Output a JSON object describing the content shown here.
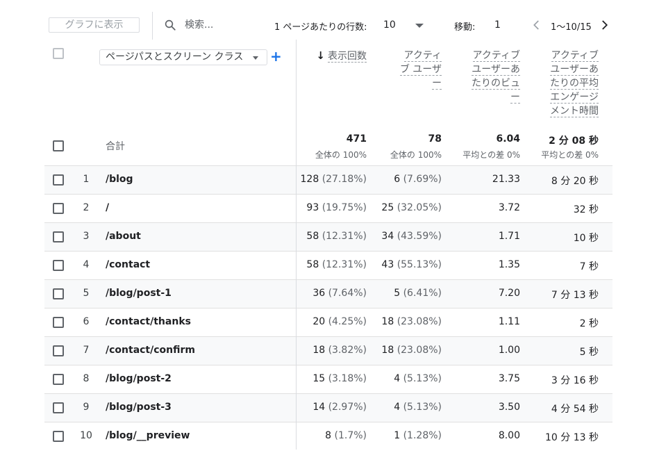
{
  "toolbar": {
    "graph_button": "グラフに表示",
    "search_placeholder": "検索...",
    "rows_per_page_label": "1 ページあたりの行数:",
    "rows_per_page_value": "10",
    "goto_label": "移動:",
    "goto_value": "1",
    "page_range": "1〜10/15"
  },
  "dimension": {
    "label": "ページパスとスクリーン クラス",
    "add_button": "+"
  },
  "columns": {
    "views": "表示回数",
    "active_users_lines": [
      "アクティ",
      "ブ ユーザ",
      "ー"
    ],
    "views_per_user_lines": [
      "アクティブ",
      "ユーザーあ",
      "たりのビュ",
      "ー"
    ],
    "avg_engagement_lines": [
      "アクティブ",
      "ユーザーあ",
      "たりの平均",
      "エンゲージ",
      "メント時間"
    ]
  },
  "totals": {
    "label": "合計",
    "views": "471",
    "views_sub": "全体の 100%",
    "active_users": "78",
    "active_users_sub": "全体の 100%",
    "views_per_user": "6.04",
    "views_per_user_sub": "平均との差 0%",
    "avg_engagement": "2 分 08 秒",
    "avg_engagement_sub": "平均との差 0%"
  },
  "rows": [
    {
      "idx": "1",
      "path": "/blog",
      "views": "128",
      "views_pct": "(27.18%)",
      "users": "6",
      "users_pct": "(7.69%)",
      "vpu": "21.33",
      "eng": "8 分 20 秒"
    },
    {
      "idx": "2",
      "path": "/",
      "views": "93",
      "views_pct": "(19.75%)",
      "users": "25",
      "users_pct": "(32.05%)",
      "vpu": "3.72",
      "eng": "32 秒"
    },
    {
      "idx": "3",
      "path": "/about",
      "views": "58",
      "views_pct": "(12.31%)",
      "users": "34",
      "users_pct": "(43.59%)",
      "vpu": "1.71",
      "eng": "10 秒"
    },
    {
      "idx": "4",
      "path": "/contact",
      "views": "58",
      "views_pct": "(12.31%)",
      "users": "43",
      "users_pct": "(55.13%)",
      "vpu": "1.35",
      "eng": "7 秒"
    },
    {
      "idx": "5",
      "path": "/blog/post-1",
      "views": "36",
      "views_pct": "(7.64%)",
      "users": "5",
      "users_pct": "(6.41%)",
      "vpu": "7.20",
      "eng": "7 分 13 秒"
    },
    {
      "idx": "6",
      "path": "/contact/thanks",
      "views": "20",
      "views_pct": "(4.25%)",
      "users": "18",
      "users_pct": "(23.08%)",
      "vpu": "1.11",
      "eng": "2 秒"
    },
    {
      "idx": "7",
      "path": "/contact/confirm",
      "views": "18",
      "views_pct": "(3.82%)",
      "users": "18",
      "users_pct": "(23.08%)",
      "vpu": "1.00",
      "eng": "5 秒"
    },
    {
      "idx": "8",
      "path": "/blog/post-2",
      "views": "15",
      "views_pct": "(3.18%)",
      "users": "4",
      "users_pct": "(5.13%)",
      "vpu": "3.75",
      "eng": "3 分 16 秒"
    },
    {
      "idx": "9",
      "path": "/blog/post-3",
      "views": "14",
      "views_pct": "(2.97%)",
      "users": "4",
      "users_pct": "(5.13%)",
      "vpu": "3.50",
      "eng": "4 分 54 秒"
    },
    {
      "idx": "10",
      "path": "/blog/__preview",
      "views": "8",
      "views_pct": "(1.7%)",
      "users": "1",
      "users_pct": "(1.28%)",
      "vpu": "8.00",
      "eng": "10 分 13 秒"
    }
  ]
}
